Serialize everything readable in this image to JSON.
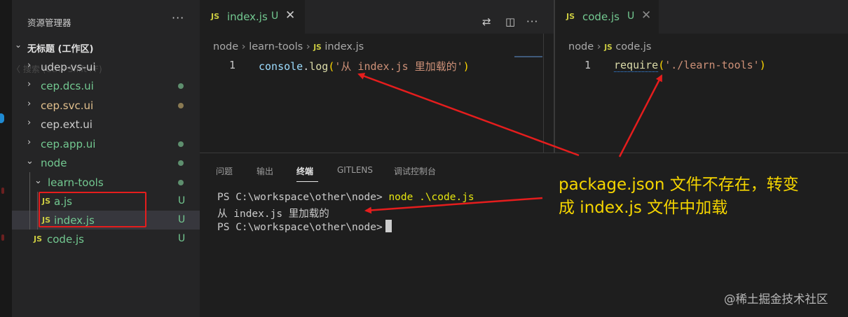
{
  "sidebar": {
    "header": "资源管理器",
    "more": "···",
    "workspace_title": "无标题 (工作区)",
    "ghost_text": "〈 搜索 (Ctrl+Shift+F)",
    "items": [
      {
        "label": "udep-vs-ui",
        "color": "#cccccc",
        "status": ""
      },
      {
        "label": "cep.dcs.ui",
        "color": "#73c991",
        "status": "dot"
      },
      {
        "label": "cep.svc.ui",
        "color": "#e2c08d",
        "status": "dot"
      },
      {
        "label": "cep.ext.ui",
        "color": "#cccccc",
        "status": ""
      },
      {
        "label": "cep.app.ui",
        "color": "#73c991",
        "status": "dot"
      },
      {
        "label": "node",
        "color": "#73c991",
        "status": "dot"
      },
      {
        "label": "learn-tools",
        "color": "#73c991",
        "status": "dot"
      },
      {
        "label": "a.js",
        "color": "#73c991",
        "status": "U"
      },
      {
        "label": "index.js",
        "color": "#73c991",
        "status": "U"
      },
      {
        "label": "code.js",
        "color": "#73c991",
        "status": "U"
      }
    ],
    "js_icon": "JS",
    "chevron_right_icon": "›",
    "chevron_down_icon": "⌄"
  },
  "editor_left": {
    "tab": {
      "icon": "JS",
      "name": "index.js",
      "status": "U",
      "close": "✕"
    },
    "breadcrumb": [
      "node",
      "learn-tools",
      "index.js"
    ],
    "line_number": "1",
    "code": {
      "fn": "console",
      "dot": ".",
      "method": "log",
      "open": "(",
      "str": "'从 index.js 里加载的'",
      "close": ")"
    }
  },
  "editor_right": {
    "tab": {
      "icon": "JS",
      "name": "code.js",
      "status": "U",
      "close": "✕"
    },
    "breadcrumb": [
      "node",
      "code.js"
    ],
    "line_number": "1",
    "code": {
      "fn": "require",
      "open": "(",
      "str": "'./learn-tools'",
      "close": ")"
    }
  },
  "toolbar": {
    "compare_icon": "⇄",
    "split_icon": "◫",
    "more": "···"
  },
  "panel": {
    "tabs": [
      "问题",
      "输出",
      "终端",
      "GITLENS",
      "调试控制台"
    ],
    "active_tab": "终端",
    "terminal": {
      "line1_prompt": "PS C:\\workspace\\other\\node>",
      "line1_cmd": "node .\\code.js",
      "line2": "从 index.js 里加载的",
      "line3_prompt": "PS C:\\workspace\\other\\node>"
    }
  },
  "annotation": {
    "line1": "package.json 文件不存在，转变",
    "line2": "成 index.js 文件中加载",
    "color": "#f5d500",
    "arrow_color": "#e51d1d"
  },
  "watermark": "@稀土掘金技术社区"
}
